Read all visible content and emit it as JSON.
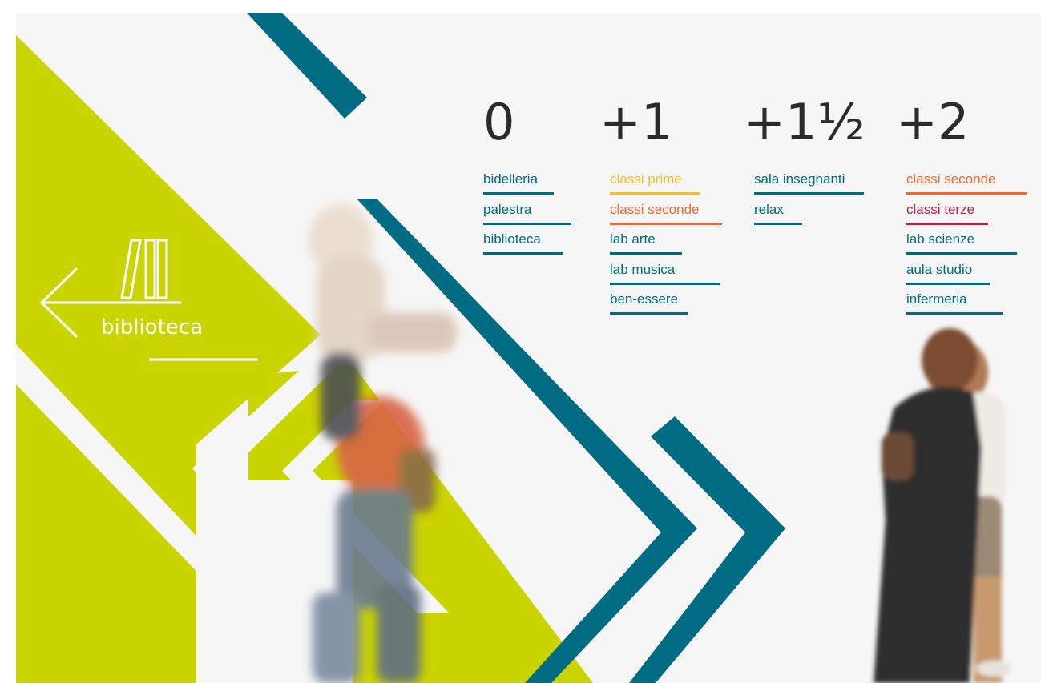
{
  "sign": {
    "label": "biblioteca",
    "icon": "books-on-shelf-icon",
    "arrow_icon": "arrow-left-icon"
  },
  "colors": {
    "background": "#f6f6f6",
    "lime": "#cad400",
    "teal": "#006c84",
    "ink": "#2b2b2b",
    "yellow": "#f2bf26",
    "orange": "#ee6a2e",
    "crimson": "#c4194a"
  },
  "floors": [
    {
      "level": "0",
      "destinations": [
        {
          "name": "bidelleria",
          "color": "#006c84"
        },
        {
          "name": "palestra",
          "color": "#006c84"
        },
        {
          "name": "biblioteca",
          "color": "#006c84"
        }
      ]
    },
    {
      "level": "+1",
      "destinations": [
        {
          "name": "classi prime",
          "color": "#f2bf26"
        },
        {
          "name": "classi seconde",
          "color": "#ee6a2e"
        },
        {
          "name": "lab arte",
          "color": "#006c84"
        },
        {
          "name": "lab musica",
          "color": "#006c84"
        },
        {
          "name": "ben-essere",
          "color": "#006c84"
        }
      ]
    },
    {
      "level": "+1½",
      "destinations": [
        {
          "name": "sala insegnanti",
          "color": "#006c84"
        },
        {
          "name": "relax",
          "color": "#006c84"
        }
      ]
    },
    {
      "level": "+2",
      "destinations": [
        {
          "name": "classi seconde",
          "color": "#ee6a2e"
        },
        {
          "name": "classi terze",
          "color": "#c4194a"
        },
        {
          "name": "lab scienze",
          "color": "#006c84"
        },
        {
          "name": "aula studio",
          "color": "#006c84"
        },
        {
          "name": "infermeria",
          "color": "#006c84"
        }
      ]
    }
  ]
}
